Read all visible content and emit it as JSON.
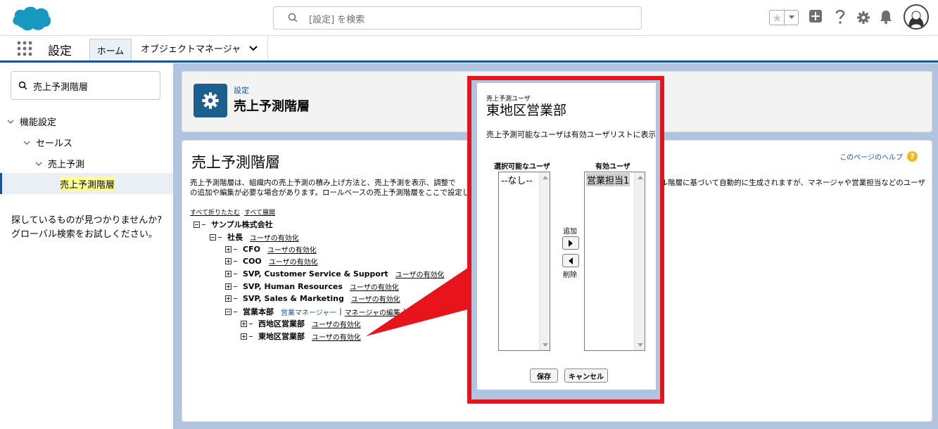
{
  "header": {
    "search_placeholder": "[設定] を検索",
    "icons": [
      "star-icon",
      "chevron-down-icon",
      "add-icon",
      "help-icon",
      "gear-icon",
      "bell-icon",
      "avatar"
    ]
  },
  "nav": {
    "app_name": "設定",
    "tabs": [
      {
        "label": "ホーム",
        "active": true
      },
      {
        "label": "オブジェクトマネージャ"
      }
    ]
  },
  "sidebar": {
    "quickfind_value": "売上予測階層",
    "tree": [
      {
        "label": "機能設定"
      },
      {
        "label": "セールス"
      },
      {
        "label": "売上予測"
      },
      {
        "label": "売上予測階層",
        "selected": true
      }
    ],
    "not_found": "探しているものが見つかりませんか? グローバル検索をお試しください。"
  },
  "page_header": {
    "breadcrumb": "設定",
    "title": "売上予測階層"
  },
  "content": {
    "title": "売上予測階層",
    "help_link": "このページのヘルプ",
    "description": "売上予測階層は、組織内の売上予測の積み上げ方法と、売上予測を表示、調整で",
    "description_right": "ル階層に基づいて自動的に生成されますが、マネージャや営業担当などのユーザ",
    "description_line2": "の追加や編集が必要な場合があります。ロールベースの売上予測階層をここで設定し、",
    "collapse_all": "すべて折りたたむ",
    "expand_all": "すべて展開",
    "activate_label": "ユーザの有効化",
    "manager_label": "営業マネージャー",
    "manager_edit": "マネージャの編集",
    "manager_sep": "|",
    "manager_trail": "ユ",
    "hierarchy": [
      {
        "label": "サンプル株式会社"
      },
      {
        "label": "社長"
      },
      {
        "label": "CFO"
      },
      {
        "label": "COO"
      },
      {
        "label": "SVP, Customer Service & Support"
      },
      {
        "label": "SVP, Human Resources"
      },
      {
        "label": "SVP, Sales & Marketing"
      },
      {
        "label": "営業本部"
      },
      {
        "label": "西地区営業部"
      },
      {
        "label": "東地区営業部"
      }
    ]
  },
  "modal": {
    "subtitle": "売上予測ユーザ",
    "title": "東地区営業部",
    "note": "売上予測可能なユーザは有効ユーザリストに表示",
    "available_label": "選択可能なユーザ",
    "active_label": "有効ユーザ",
    "available_options": [
      "--なし--"
    ],
    "active_options": [
      "営業担当1"
    ],
    "add_label": "追加",
    "remove_label": "削除",
    "save_label": "保存",
    "cancel_label": "キャンセル"
  },
  "colors": {
    "callout_red": "#e8141c",
    "brand_blue": "#1b5297",
    "logo_blue": "#1798c1"
  }
}
